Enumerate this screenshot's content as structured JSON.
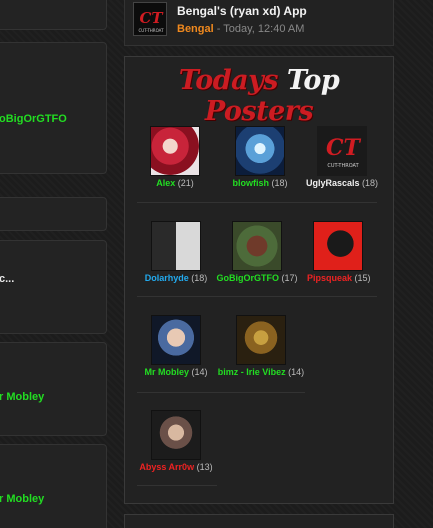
{
  "app": {
    "title": "Bengal's (ryan xd) App",
    "author": "Bengal",
    "time": " - Today, 12:40 AM",
    "logo_text": "CUT-THROAT"
  },
  "left_items": [
    {
      "label": "oBigOrGTFO"
    },
    {
      "label": "c..."
    },
    {
      "label": "r Mobley"
    },
    {
      "label": "r Mobley"
    }
  ],
  "panel": {
    "title_word1": "Todays",
    "title_word2": "Top",
    "title_word3": "Posters"
  },
  "posters": [
    {
      "name": "Alex",
      "count": "(21)",
      "color": "#22dd22"
    },
    {
      "name": "blowfish",
      "count": "(18)",
      "color": "#22dd22"
    },
    {
      "name": "UglyRascals",
      "count": "(18)",
      "color": "#f0f0f0"
    },
    {
      "name": "Dolarhyde",
      "count": "(18)",
      "color": "#22aaee"
    },
    {
      "name": "GoBigOrGTFO",
      "count": "(17)",
      "color": "#22dd22"
    },
    {
      "name": "Pipsqueak",
      "count": "(15)",
      "color": "#ee2222"
    },
    {
      "name": "Mr Mobley",
      "count": "(14)",
      "color": "#22dd22"
    },
    {
      "name": "bimz - Irie Vibez",
      "count": "(14)",
      "color": "#22dd22"
    },
    {
      "name": "Abyss Arr0w",
      "count": "(13)",
      "color": "#ee2222"
    }
  ]
}
